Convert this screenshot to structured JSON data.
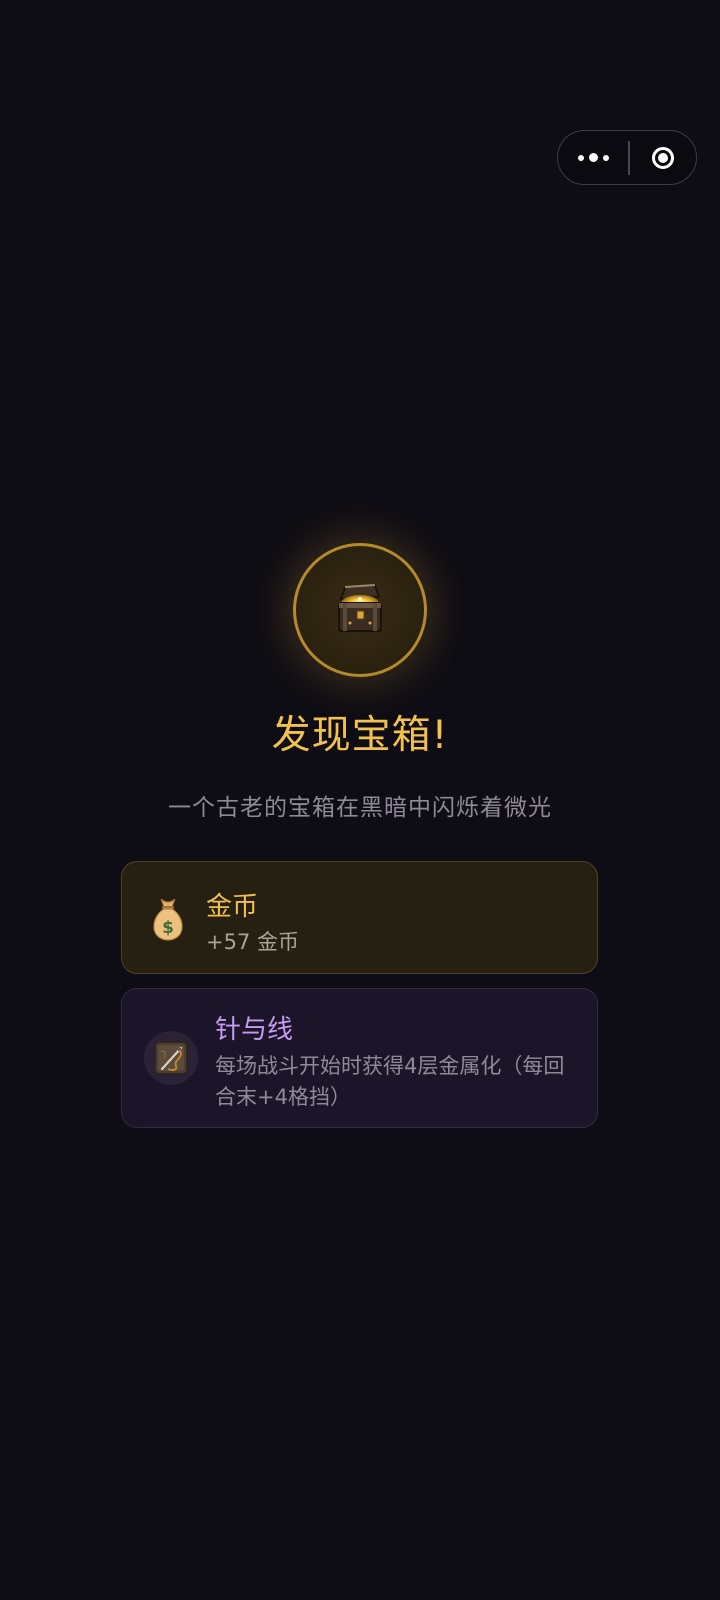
{
  "capsule": {
    "more_icon": "more-dots-icon",
    "close_icon": "target-close-icon"
  },
  "event": {
    "icon": "treasure-chest-icon",
    "title": "发现宝箱!",
    "subtitle": "一个古老的宝箱在黑暗中闪烁着微光"
  },
  "rewards": [
    {
      "icon": "money-bag-icon",
      "name": "金币",
      "desc": "+57 金币"
    },
    {
      "icon": "needle-thread-icon",
      "name": "针与线",
      "desc": "每场战斗开始时获得4层金属化（每回合末+4格挡）"
    }
  ],
  "colors": {
    "background": "#0e0c14",
    "gold_accent": "#f2c14e",
    "relic_accent": "#c59cf2",
    "gold_card_bg": "#262013",
    "relic_card_bg": "#1c1428"
  }
}
